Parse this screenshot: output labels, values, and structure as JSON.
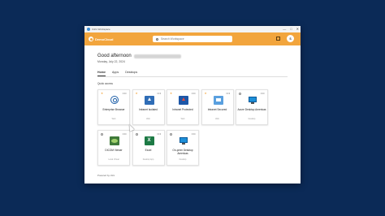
{
  "window": {
    "title": "Citrix Workspace",
    "controls": [
      "—",
      "□",
      "✕"
    ]
  },
  "header": {
    "brand": "DemoCloud",
    "search_placeholder": "Search Workspace",
    "avatar_initial": "S",
    "accent": "#f2a53d"
  },
  "greeting": {
    "text": "Good afternoon",
    "date": "Monday, July 22, 2024"
  },
  "tabs": [
    {
      "label": "Home",
      "active": true
    },
    {
      "label": "Apps",
      "active": false
    },
    {
      "label": "Desktops",
      "active": false
    }
  ],
  "section_title": "Quick access",
  "cards": [
    {
      "name": "Enterprise Browser",
      "type": "Web",
      "favorite": true,
      "icon": "browser-icon"
    },
    {
      "name": "Intranet Isolated",
      "type": "Web",
      "favorite": true,
      "icon": "intranet-icon"
    },
    {
      "name": "Intranet Protected",
      "type": "Web",
      "favorite": true,
      "icon": "intranet-protected-icon"
    },
    {
      "name": "Intranet Secured",
      "type": "Web",
      "favorite": true,
      "icon": "intranet-secured-icon"
    },
    {
      "name": "Azure Desktop Americas",
      "type": "Desktop",
      "favorite": false,
      "icon": "desktop-icon"
    },
    {
      "name": "DICOM Viewer",
      "type": "Local Virtual",
      "favorite": false,
      "icon": "dicom-icon"
    },
    {
      "name": "Excel",
      "type": "Desktop App",
      "favorite": false,
      "icon": "excel-icon"
    },
    {
      "name": "On-prem Desktop Americas",
      "type": "Desktop",
      "favorite": false,
      "icon": "desktop-icon"
    }
  ],
  "footer": "Powered by citrix"
}
